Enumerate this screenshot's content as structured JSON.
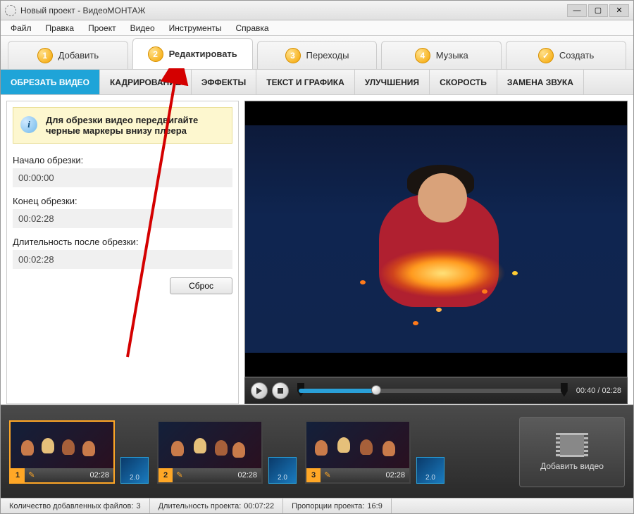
{
  "window": {
    "title": "Новый проект - ВидеоМОНТАЖ"
  },
  "menu": [
    "Файл",
    "Правка",
    "Проект",
    "Видео",
    "Инструменты",
    "Справка"
  ],
  "steps": [
    {
      "num": "1",
      "label": "Добавить"
    },
    {
      "num": "2",
      "label": "Редактировать"
    },
    {
      "num": "3",
      "label": "Переходы"
    },
    {
      "num": "4",
      "label": "Музыка"
    },
    {
      "num": "✓",
      "label": "Создать"
    }
  ],
  "subtabs": [
    "ОБРЕЗАТЬ ВИДЕО",
    "КАДРИРОВАНИЕ",
    "ЭФФЕКТЫ",
    "ТЕКСТ И ГРАФИКА",
    "УЛУЧШЕНИЯ",
    "СКОРОСТЬ",
    "ЗАМЕНА ЗВУКА"
  ],
  "trim": {
    "hint": "Для обрезки видео передвигайте черные маркеры внизу плеера",
    "start_label": "Начало обрезки:",
    "start_value": "00:00:00",
    "end_label": "Конец обрезки:",
    "end_value": "00:02:28",
    "duration_label": "Длительность после обрезки:",
    "duration_value": "00:02:28",
    "reset": "Сброс"
  },
  "player": {
    "time": "00:40 / 02:28"
  },
  "timeline": {
    "clips": [
      {
        "num": "1",
        "dur": "02:28"
      },
      {
        "num": "2",
        "dur": "02:28"
      },
      {
        "num": "3",
        "dur": "02:28"
      }
    ],
    "transition": "2.0",
    "add_label": "Добавить видео"
  },
  "status": {
    "files_label": "Количество добавленных файлов:",
    "files_value": "3",
    "duration_label": "Длительность проекта:",
    "duration_value": "00:07:22",
    "aspect_label": "Пропорции проекта:",
    "aspect_value": "16:9"
  }
}
